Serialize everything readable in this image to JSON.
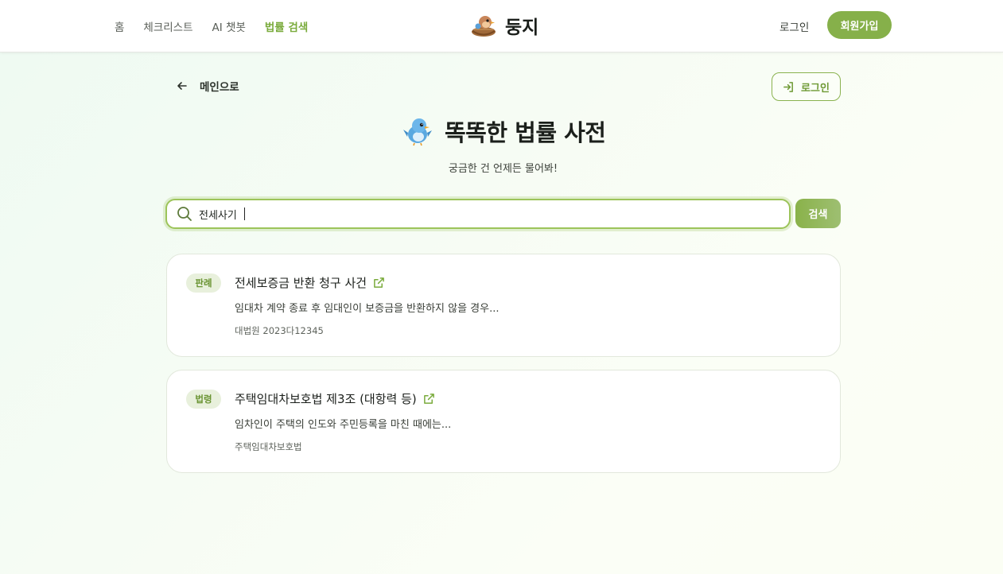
{
  "nav": {
    "items": [
      {
        "label": "홈",
        "active": false
      },
      {
        "label": "체크리스트",
        "active": false
      },
      {
        "label": "AI 챗봇",
        "active": false
      },
      {
        "label": "법률 검색",
        "active": true
      }
    ]
  },
  "brand": {
    "name": "둥지",
    "logo_icon": "nest-bird-icon"
  },
  "header": {
    "login_label": "로그인",
    "signup_label": "회원가입"
  },
  "back": {
    "label": "메인으로"
  },
  "login_button": {
    "label": "로그인"
  },
  "hero": {
    "title": "똑똑한 법률 사전",
    "subtitle": "궁금한 건 언제든 물어봐!",
    "icon": "bluebird-icon"
  },
  "search": {
    "value": "전세사기",
    "button_label": "검색"
  },
  "results": [
    {
      "badge": "판례",
      "title": "전세보증금 반환 청구 사건",
      "description": "임대차 계약 종료 후 임대인이 보증금을 반환하지 않을 경우...",
      "meta": "대법원 2023다12345"
    },
    {
      "badge": "법령",
      "title": "주택임대차보호법 제3조 (대항력 등)",
      "description": "임차인이 주택의 인도와 주민등록을 마친 때에는...",
      "meta": "주택임대차보호법"
    }
  ],
  "colors": {
    "accent": "#86b04a",
    "accent_dark": "#6f9a35",
    "badge_bg": "#e8f0dc"
  }
}
